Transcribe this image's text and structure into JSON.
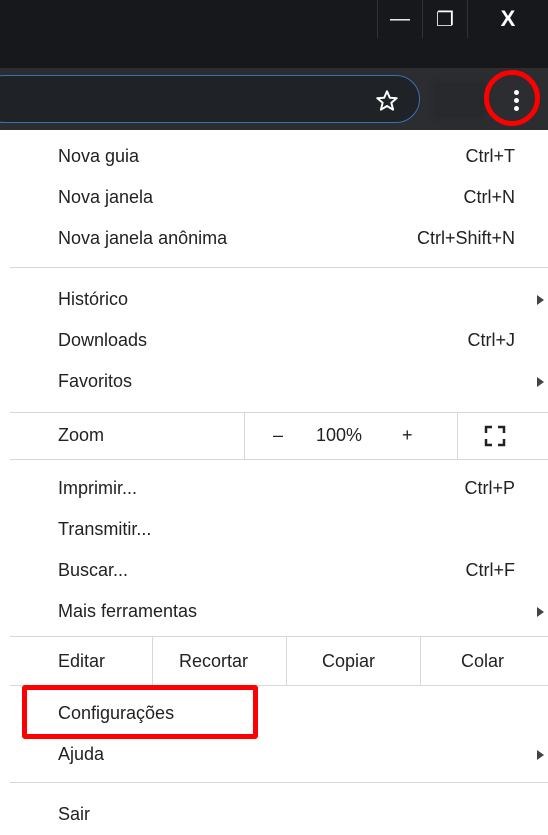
{
  "window": {
    "minimize_glyph": "—",
    "restore_glyph": "❐",
    "close_glyph": "X"
  },
  "toolbar": {
    "bookmark_icon": "star-icon",
    "menu_icon": "kebab-icon"
  },
  "menu": {
    "group1": [
      {
        "label": "Nova guia",
        "shortcut": "Ctrl+T"
      },
      {
        "label": "Nova janela",
        "shortcut": "Ctrl+N"
      },
      {
        "label": "Nova janela anônima",
        "shortcut": "Ctrl+Shift+N"
      }
    ],
    "group2": [
      {
        "label": "Histórico",
        "shortcut": ""
      },
      {
        "label": "Downloads",
        "shortcut": "Ctrl+J"
      },
      {
        "label": "Favoritos",
        "shortcut": ""
      }
    ],
    "zoom": {
      "label": "Zoom",
      "minus": "–",
      "value": "100%",
      "plus": "+"
    },
    "group3": [
      {
        "label": "Imprimir...",
        "shortcut": "Ctrl+P"
      },
      {
        "label": "Transmitir...",
        "shortcut": ""
      },
      {
        "label": "Buscar...",
        "shortcut": "Ctrl+F"
      },
      {
        "label": "Mais ferramentas",
        "shortcut": ""
      }
    ],
    "edit": {
      "label": "Editar",
      "cut": "Recortar",
      "copy": "Copiar",
      "paste": "Colar"
    },
    "group4": [
      {
        "label": "Configurações",
        "shortcut": ""
      },
      {
        "label": "Ajuda",
        "shortcut": ""
      }
    ],
    "exit": {
      "label": "Sair"
    }
  },
  "colors": {
    "highlight": "#ff0000",
    "titlebar": "#16181c",
    "toolbar": "#2b2d31"
  }
}
